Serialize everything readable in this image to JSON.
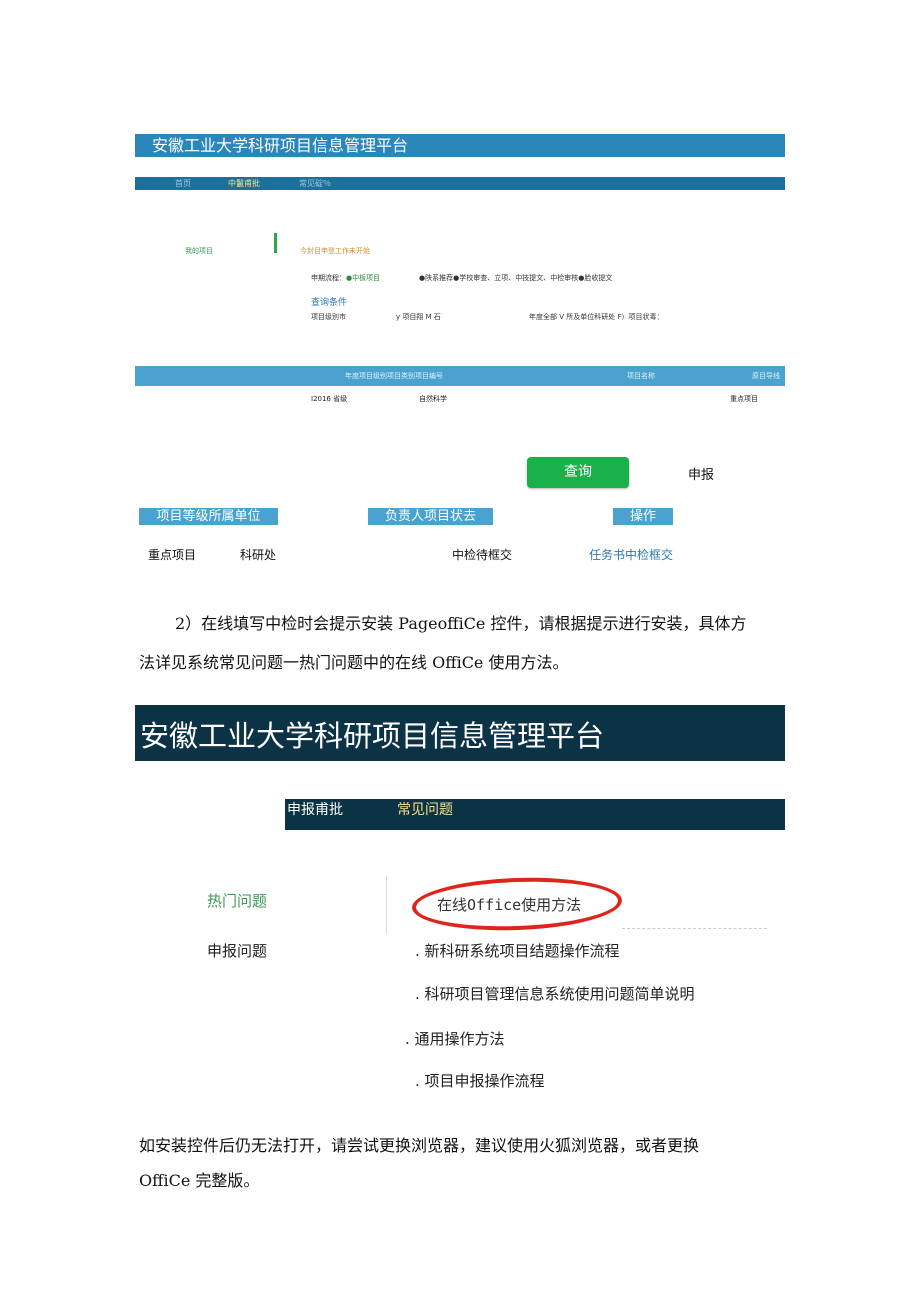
{
  "shot1": {
    "title": "安徽工业大学科研项目信息管理平台",
    "nav": [
      "首页",
      "中鬣甫批",
      "常见碇％"
    ],
    "my_projects": "我的项目",
    "notice": "今封目申登工作未开始",
    "flow_prefix": "申期流程：",
    "flow_step1": "●中板项目",
    "flow_step2": "●陕系推荐●学校审查、立项、中技提文、中检审核●脸收提文",
    "query_label": "查询条件",
    "filter_a": "项目级別市",
    "filter_b": "y 项目翔 M 石",
    "filter_c": "年度全部 V 所及单位科研处 F）项目状毒：",
    "table_header_main": "年度项目级别项目类别项目编号",
    "table_header_name": "项目名称",
    "table_header_guide": "原目导线",
    "row_year_level": "I2016 省级",
    "row_category": "自然科学",
    "row_key": "重点项目",
    "query_button": "查询",
    "declare": "申报",
    "label_level_unit": "项目等级所属单位",
    "label_owner_status": "负责人项目状去",
    "label_action": "操作",
    "result_key": "重点项目",
    "result_unit": "科研处",
    "result_status": "中检待框交",
    "result_action": "任务书中检框交"
  },
  "para1_line1": "2）在线填写中检时会提示安装 PageoffiCe 控件，请根据提示进行安装，具体方",
  "para1_line2": "法详见系统常见问题一热门问题中的在线 OffiCe 使用方法。",
  "shot2": {
    "title": "安徽工业大学科研项目信息管理平台",
    "nav_declare": "申报甫批",
    "nav_faq": "常见问题",
    "hot_questions": "热门问题",
    "office_method": "在线Office使用方法",
    "declare_questions": "申报问题",
    "faq_items": [
      ". 新科研系统项目结题操作流程",
      ". 科研项目管理信息系统使用问题简单说明",
      ". 通用操作方法",
      ". 项目申报操作流程"
    ]
  },
  "para2_line1": "如安装控件后仍无法打开，请尝试更换浏览器，建议使用火狐浏览器，或者更换",
  "para2_line2": "OffiCe 完整版。",
  "colors": {
    "title_blue": "#2b86ba",
    "nav_blue": "#1f6f9b",
    "table_blue": "#4aa3cf",
    "button_green": "#19b24a",
    "dark_navy": "#0c3246",
    "circle_red": "#e0241b"
  }
}
